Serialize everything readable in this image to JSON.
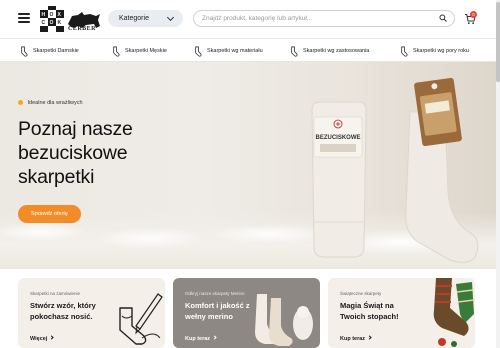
{
  "header": {
    "logo_text": "CERBER",
    "categories_label": "Kategorie",
    "search_placeholder": "Znajdź produkt, kategorię lub artykuł...",
    "cart_count": "0"
  },
  "nav": {
    "items": [
      {
        "label": "Skarpetki Damskie",
        "icon": "sock-icon"
      },
      {
        "label": "Skarpetki Męskie",
        "icon": "sock-icon"
      },
      {
        "label": "Skarpetki wg materiału",
        "icon": "sock-icon"
      },
      {
        "label": "Skarpetki wg zastosowania",
        "icon": "sock-icon"
      },
      {
        "label": "Skarpetki wg pory roku",
        "icon": "sock-icon"
      }
    ]
  },
  "hero": {
    "tagline": "Idealne dla wrażliwych",
    "title_line1": "Poznaj nasze",
    "title_line2": "bezuciskowe",
    "title_line3": "skarpetki",
    "cta_label": "Sprawdź ofertę",
    "label_big": "BEZUCISKOWE"
  },
  "cards": [
    {
      "kicker": "Skarpetki na zamówienie",
      "title": "Stwórz wzór, który pokochasz nosić.",
      "link": "Więcej"
    },
    {
      "kicker": "Odkryj nasze skarpety Merino",
      "title": "Komfort i jakość z wełny merino",
      "link": "Kup teraz"
    },
    {
      "kicker": "Świąteczne skarpety",
      "title": "Magia Świąt na Twoich stopach!",
      "link": "Kup teraz"
    }
  ],
  "colors": {
    "accent": "#f28c28",
    "badge": "#e2463b",
    "card_merino": "#8d8883"
  }
}
